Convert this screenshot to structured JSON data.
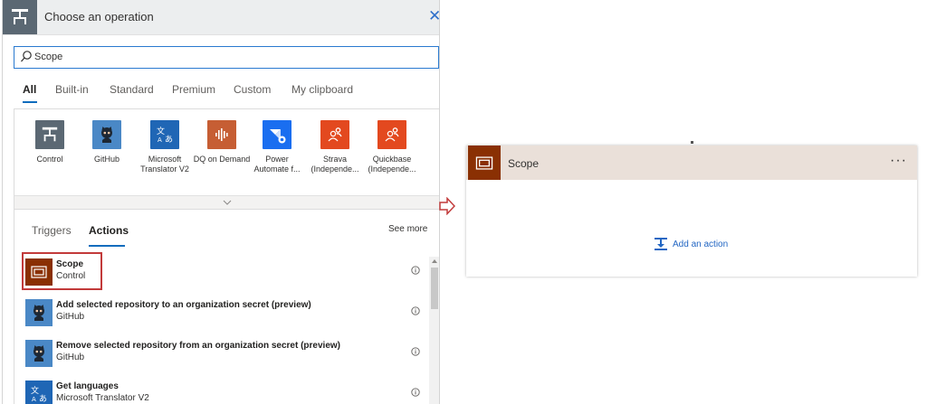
{
  "dialog": {
    "title": "Choose an operation",
    "close_icon": "close-icon"
  },
  "search": {
    "value": "Scope",
    "placeholder": ""
  },
  "tabs": [
    "All",
    "Built-in",
    "Standard",
    "Premium",
    "Custom",
    "My clipboard"
  ],
  "active_tab": "All",
  "connectors": [
    {
      "label": "Control",
      "icon": "control-icon",
      "color": "#5b6873"
    },
    {
      "label": "GitHub",
      "icon": "github-icon",
      "color": "#4a88c6"
    },
    {
      "label": "Microsoft Translator V2",
      "icon": "translator-icon",
      "color": "#1f66b5"
    },
    {
      "label": "DQ on Demand",
      "icon": "soundwave-icon",
      "color": "#c65e34"
    },
    {
      "label": "Power Automate f...",
      "icon": "power-automate-icon",
      "color": "#1a6ef0"
    },
    {
      "label": "Strava (Independe...",
      "icon": "people-icon",
      "color": "#e3491f"
    },
    {
      "label": "Quickbase (Independe...",
      "icon": "people-icon",
      "color": "#e3491f"
    }
  ],
  "subtabs": [
    "Triggers",
    "Actions"
  ],
  "active_subtab": "Actions",
  "see_more": "See more",
  "actions": [
    {
      "title": "Scope",
      "subtitle": "Control",
      "icon": "scope-icon",
      "color": "#8a3003"
    },
    {
      "title": "Add selected repository to an organization secret (preview)",
      "subtitle": "GitHub",
      "icon": "github-icon",
      "color": "#4a88c6"
    },
    {
      "title": "Remove selected repository from an organization secret (preview)",
      "subtitle": "GitHub",
      "icon": "github-icon",
      "color": "#4a88c6"
    },
    {
      "title": "Get languages",
      "subtitle": "Microsoft Translator V2",
      "icon": "translator-icon",
      "color": "#1f66b5"
    }
  ],
  "scope_card": {
    "title": "Scope",
    "more": "···",
    "add_action": "Add an action",
    "header_color": "#eae0d9",
    "icon_color": "#8a3003"
  },
  "colors": {
    "accent": "#0f6cbd",
    "highlight_border": "#c23a3a",
    "link": "#2266c3"
  }
}
